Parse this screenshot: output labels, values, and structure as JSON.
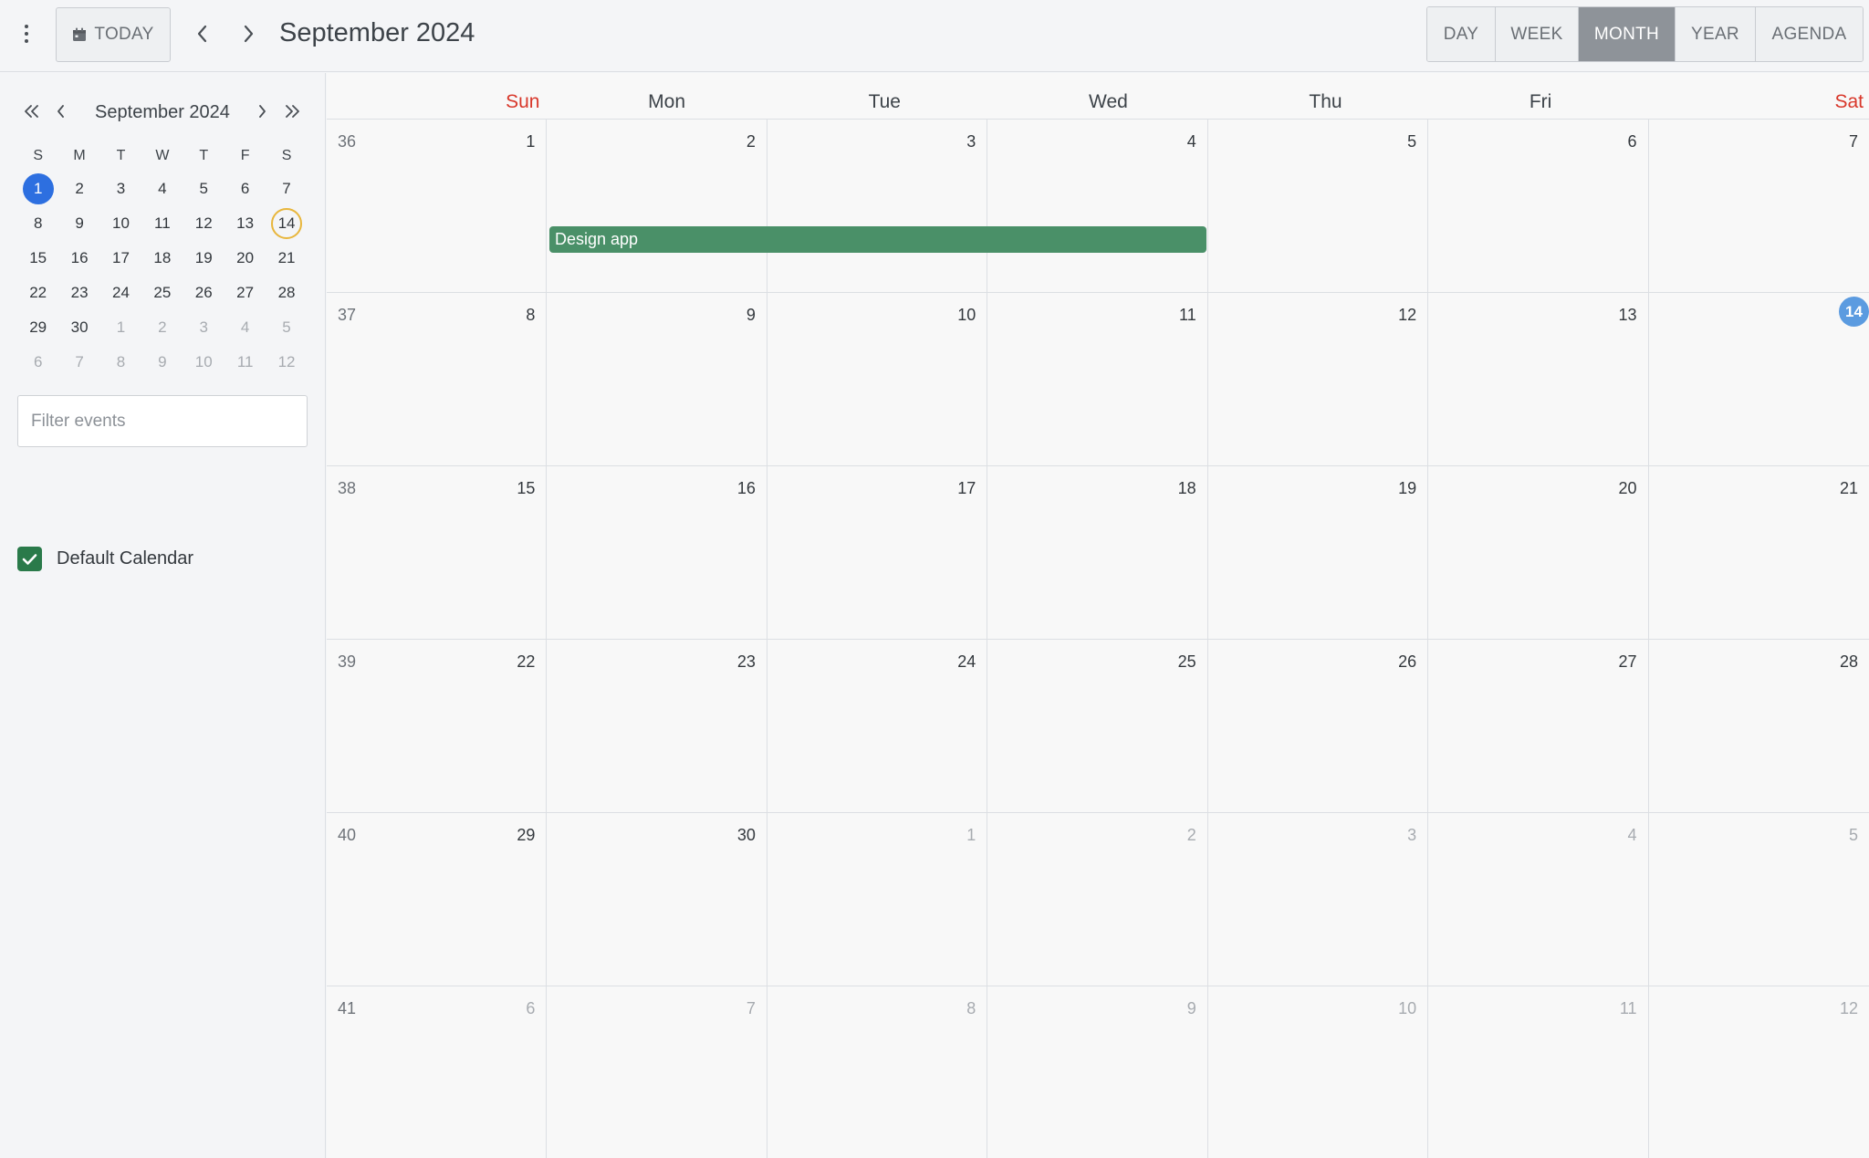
{
  "toolbar": {
    "today_label": "TODAY",
    "title": "September 2024",
    "views": [
      {
        "label": "DAY",
        "active": false
      },
      {
        "label": "WEEK",
        "active": false
      },
      {
        "label": "MONTH",
        "active": true
      },
      {
        "label": "YEAR",
        "active": false
      },
      {
        "label": "AGENDA",
        "active": false
      }
    ],
    "icons": {
      "menu": "kebab-menu-icon",
      "today": "calendar-icon",
      "prev": "chevron-left-icon",
      "next": "chevron-right-icon"
    }
  },
  "sidebar": {
    "mini_calendar": {
      "title": "September 2024",
      "weekday_headers": [
        "S",
        "M",
        "T",
        "W",
        "T",
        "F",
        "S"
      ],
      "weeks": [
        [
          "1",
          "2",
          "3",
          "4",
          "5",
          "6",
          "7"
        ],
        [
          "8",
          "9",
          "10",
          "11",
          "12",
          "13",
          "14"
        ],
        [
          "15",
          "16",
          "17",
          "18",
          "19",
          "20",
          "21"
        ],
        [
          "22",
          "23",
          "24",
          "25",
          "26",
          "27",
          "28"
        ],
        [
          "29",
          "30",
          "1",
          "2",
          "3",
          "4",
          "5"
        ],
        [
          "6",
          "7",
          "8",
          "9",
          "10",
          "11",
          "12"
        ]
      ],
      "selected_day": "1",
      "today_day": "14"
    },
    "filter_placeholder": "Filter events",
    "calendars": [
      {
        "label": "Default Calendar",
        "checked": true,
        "color": "#2a7a4a"
      }
    ]
  },
  "month_view": {
    "weekdays": [
      "Sun",
      "Mon",
      "Tue",
      "Wed",
      "Thu",
      "Fri",
      "Sat"
    ],
    "weeks": [
      {
        "week": "36",
        "days": [
          "1",
          "2",
          "3",
          "4",
          "5",
          "6",
          "7"
        ]
      },
      {
        "week": "37",
        "days": [
          "8",
          "9",
          "10",
          "11",
          "12",
          "13",
          "14"
        ]
      },
      {
        "week": "38",
        "days": [
          "15",
          "16",
          "17",
          "18",
          "19",
          "20",
          "21"
        ]
      },
      {
        "week": "39",
        "days": [
          "22",
          "23",
          "24",
          "25",
          "26",
          "27",
          "28"
        ]
      },
      {
        "week": "40",
        "days": [
          "29",
          "30",
          "1",
          "2",
          "3",
          "4",
          "5"
        ]
      },
      {
        "week": "41",
        "days": [
          "6",
          "7",
          "8",
          "9",
          "10",
          "11",
          "12"
        ]
      }
    ],
    "today": "14",
    "events": [
      {
        "title": "Design app",
        "start_day": "2",
        "end_day": "4",
        "color": "#4a9068"
      }
    ]
  },
  "colors": {
    "weekend": "#d8372a",
    "selected": "#2d6fe0",
    "today_ring": "#e8b63c",
    "today_badge": "#5b9be0",
    "active_view": "#8e9399"
  }
}
